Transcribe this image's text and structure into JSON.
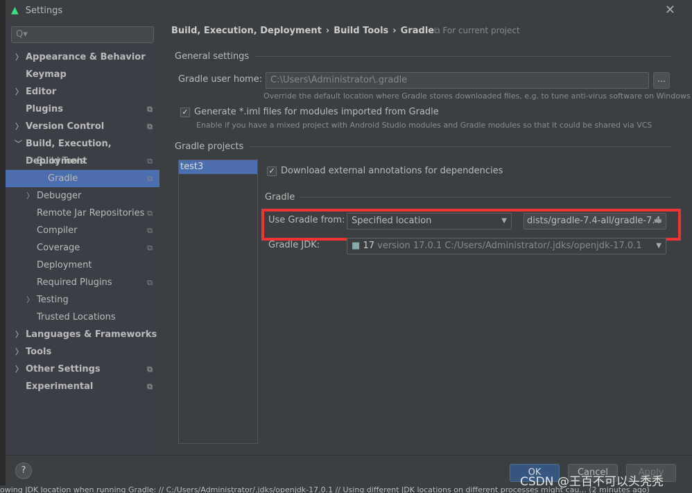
{
  "window": {
    "title": "Settings"
  },
  "search": {
    "placeholder": "Q▾"
  },
  "sidebar": {
    "items": [
      {
        "label": "Appearance & Behavior"
      },
      {
        "label": "Keymap"
      },
      {
        "label": "Editor"
      },
      {
        "label": "Plugins"
      },
      {
        "label": "Version Control"
      },
      {
        "label": "Build, Execution, Deployment"
      },
      {
        "label": "Build Tools"
      },
      {
        "label": "Gradle"
      },
      {
        "label": "Debugger"
      },
      {
        "label": "Remote Jar Repositories"
      },
      {
        "label": "Compiler"
      },
      {
        "label": "Coverage"
      },
      {
        "label": "Deployment"
      },
      {
        "label": "Required Plugins"
      },
      {
        "label": "Testing"
      },
      {
        "label": "Trusted Locations"
      },
      {
        "label": "Languages & Frameworks"
      },
      {
        "label": "Tools"
      },
      {
        "label": "Other Settings"
      },
      {
        "label": "Experimental"
      }
    ]
  },
  "breadcrumb": [
    "Build, Execution, Deployment",
    "›",
    "Build Tools",
    "›",
    "Gradle"
  ],
  "for_current_project": "⧉ For current project",
  "general": {
    "title": "General settings",
    "home_label": "Gradle user home:",
    "home_value": "C:\\Users\\Administrator\\.gradle",
    "browse": "...",
    "home_hint": "Override the default location where Gradle stores downloaded files, e.g. to tune anti-virus software on Windows",
    "iml_label": "Generate *.iml files for modules imported from Gradle",
    "iml_hint": "Enable if you have a mixed project with Android Studio modules and Gradle modules so that it could be shared via VCS"
  },
  "projects": {
    "title": "Gradle projects",
    "items": [
      "test3"
    ],
    "download_label": "Download external annotations for dependencies",
    "gradle_section": "Gradle",
    "use_from_label": "Use Gradle from:",
    "use_from_value": "Specified location",
    "location_value": "dists/gradle-7.4-all/gradle-7.4",
    "jdk_label": "Gradle JDK:",
    "jdk_version": "17",
    "jdk_detail": "version 17.0.1 C:/Users/Administrator/.jdks/openjdk-17.0.1"
  },
  "footer": {
    "help": "?",
    "ok": "OK",
    "cancel": "Cancel",
    "apply": "Apply"
  },
  "status": "owing JDK location when running Gradle: // C:/Users/Administrator/.jdks/openjdk-17.0.1 // Using different JDK locations on different processes might cau... (2 minutes ago)",
  "watermark": "CSDN @王百不可以头秃秃"
}
